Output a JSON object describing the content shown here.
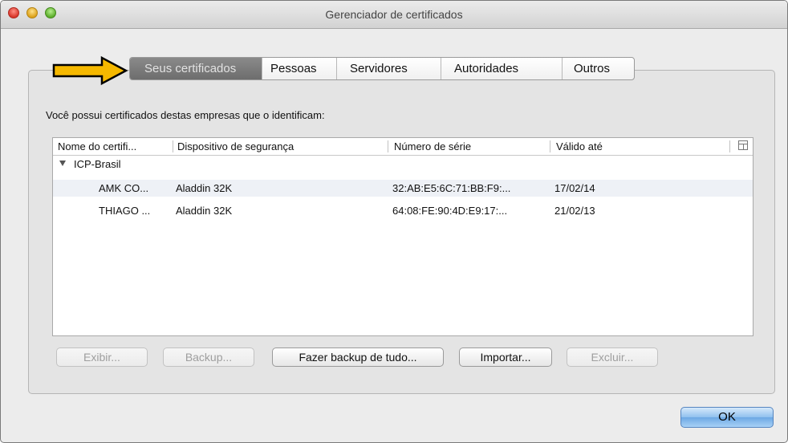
{
  "window": {
    "title": "Gerenciador de certificados"
  },
  "tabs": [
    {
      "label": "Seus certificados",
      "active": true
    },
    {
      "label": "Pessoas",
      "active": false
    },
    {
      "label": "Servidores",
      "active": false
    },
    {
      "label": "Autoridades",
      "active": false
    },
    {
      "label": "Outros",
      "active": false
    }
  ],
  "description": "Você possui certificados destas empresas que o identificam:",
  "table": {
    "columns": [
      "Nome do certifi...",
      "Dispositivo de segurança",
      "Número de série",
      "Válido até"
    ],
    "group": {
      "label": "ICP-Brasil",
      "expanded": true
    },
    "rows": [
      {
        "name": "AMK CO...",
        "device": "Aladdin 32K",
        "serial": "32:AB:E5:6C:71:BB:F9:...",
        "valid": "17/02/14"
      },
      {
        "name": "THIAGO ...",
        "device": "Aladdin 32K",
        "serial": "64:08:FE:90:4D:E9:17:...",
        "valid": "21/02/13"
      }
    ]
  },
  "buttons": {
    "view": "Exibir...",
    "backup": "Backup...",
    "backup_all": "Fazer backup de tudo...",
    "import": "Importar...",
    "delete": "Excluir...",
    "ok": "OK"
  },
  "colors": {
    "arrow_fill": "#f5b800",
    "active_tab": "#7a7a7a",
    "ok_button": "#8fc0ef"
  },
  "icons": {
    "close": "close-icon",
    "minimize": "minimize-icon",
    "zoom": "zoom-icon",
    "annotation_arrow": "arrow-right-icon",
    "disclosure": "disclosure-triangle-icon",
    "column_picker": "column-picker-icon"
  }
}
